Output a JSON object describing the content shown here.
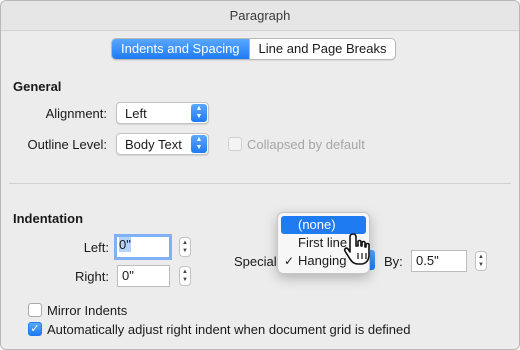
{
  "window": {
    "title": "Paragraph"
  },
  "tabs": [
    {
      "label": "Indents and Spacing",
      "active": true
    },
    {
      "label": "Line and Page Breaks",
      "active": false
    }
  ],
  "general": {
    "title": "General",
    "alignment_label": "Alignment:",
    "alignment_value": "Left",
    "outline_label": "Outline Level:",
    "outline_value": "Body Text",
    "collapsed_label": "Collapsed by default"
  },
  "indentation": {
    "title": "Indentation",
    "left_label": "Left:",
    "left_value": "0\"",
    "right_label": "Right:",
    "right_value": "0\"",
    "special_label": "Special",
    "by_label": "By:",
    "by_value": "0.5\"",
    "special_menu": {
      "items": [
        {
          "label": "(none)",
          "highlighted": true,
          "checked": false
        },
        {
          "label": "First line",
          "highlighted": false,
          "checked": false
        },
        {
          "label": "Hanging",
          "highlighted": false,
          "checked": true
        }
      ]
    },
    "mirror_label": "Mirror Indents",
    "auto_adjust_label": "Automatically adjust right indent when document grid is defined"
  },
  "colors": {
    "accent": "#1f7bf2",
    "focus_ring": "#7fb0f5"
  },
  "icons": {
    "check": "checkmark-icon",
    "popup_arrows": "up-down-chevron-icon",
    "cursor": "pointer-cursor-icon"
  }
}
